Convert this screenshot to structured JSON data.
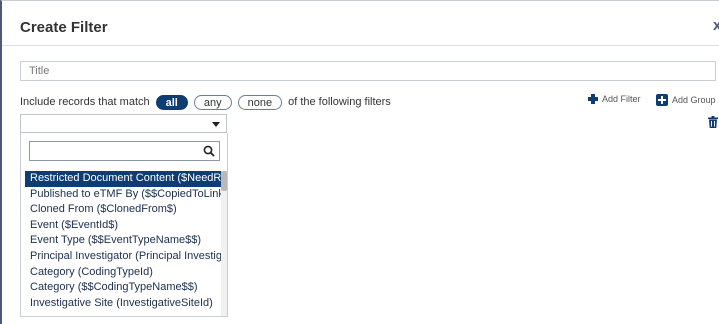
{
  "dialog": {
    "title": "Create Filter",
    "close_glyph": "x"
  },
  "title_field": {
    "placeholder": "Title"
  },
  "match_row": {
    "prefix": "Include records that match",
    "options": [
      "all",
      "any",
      "none"
    ],
    "selected": "all",
    "suffix": "of the following filters"
  },
  "toolbar": {
    "add_filter_label": "Add Filter",
    "add_group_label": "Add Group"
  },
  "field_select": {
    "value": "",
    "search_value": ""
  },
  "dropdown_options": [
    "Restricted Document Content ($NeedRe",
    "Published to eTMF By ($$CopiedToLinke",
    "Cloned From ($ClonedFrom$)",
    "Event ($EventId$)",
    "Event Type ($$EventTypeName$$)",
    "Principal Investigator (Principal Investiga",
    "Category (CodingTypeId)",
    "Category ($$CodingTypeName$$)",
    "Investigative Site (InvestigativeSiteId)"
  ],
  "selected_option_index": 0,
  "icons": {
    "add_filter": "plus-icon",
    "add_group": "plus-square-icon",
    "delete": "trash-icon",
    "search": "search-icon",
    "dropdown": "caret-down-icon"
  },
  "colors": {
    "accent": "#0f3c73",
    "border": "#c9ced6"
  }
}
